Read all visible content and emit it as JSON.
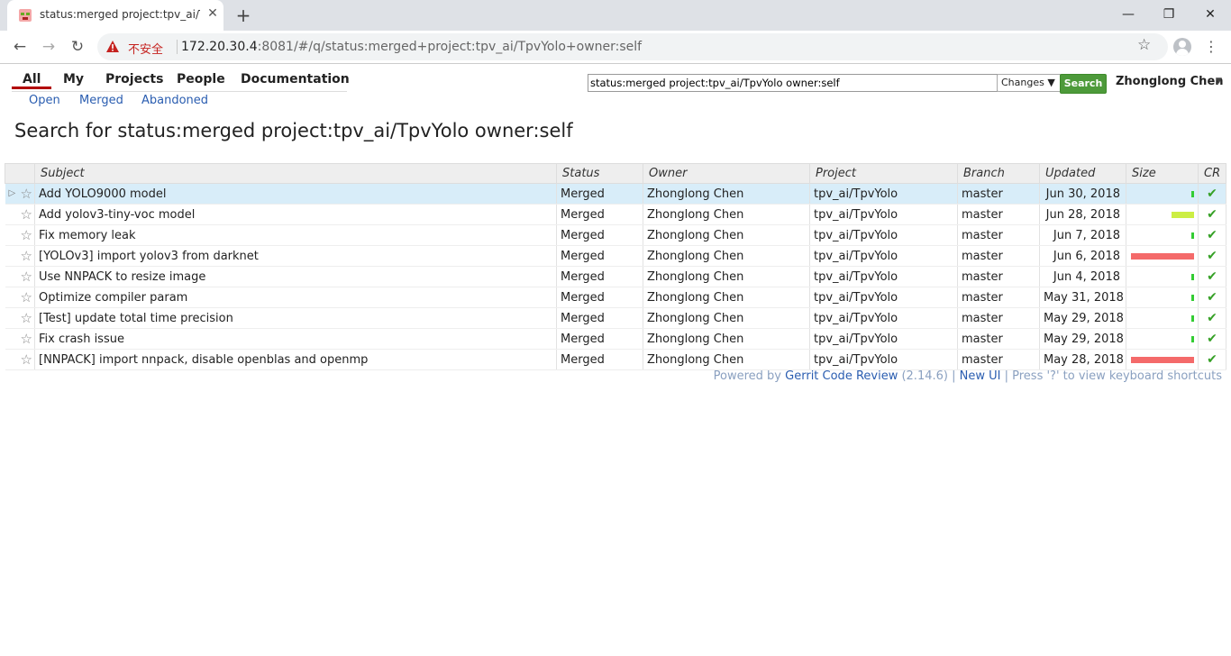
{
  "browser": {
    "tab_title": "status:merged project:tpv_ai/TpvYolo owner:self",
    "address_security": "不安全",
    "address_host": "172.20.30.4",
    "address_rest": ":8081/#/q/status:merged+project:tpv_ai/TpvYolo+owner:self"
  },
  "nav": {
    "tabs": [
      "All",
      "My",
      "Projects",
      "People",
      "Documentation"
    ],
    "subtabs": [
      "Open",
      "Merged",
      "Abandoned"
    ],
    "search_value": "status:merged project:tpv_ai/TpvYolo owner:self",
    "dropdown_value": "Changes",
    "search_button": "Search",
    "user_name": "Zhonglong Chen"
  },
  "title": "Search for status:merged project:tpv_ai/TpvYolo owner:self",
  "table": {
    "headers": [
      "Subject",
      "Status",
      "Owner",
      "Project",
      "Branch",
      "Updated",
      "Size",
      "CR"
    ],
    "rows": [
      {
        "subject": "Add YOLO9000 model",
        "status": "Merged",
        "owner": "Zhonglong Chen",
        "project": "tpv_ai/TpvYolo",
        "branch": "master",
        "updated": "Jun 30, 2018",
        "size_bar": 0.04,
        "size_color": "#33cc33",
        "cr": "✔"
      },
      {
        "subject": "Add yolov3-tiny-voc model",
        "status": "Merged",
        "owner": "Zhonglong Chen",
        "project": "tpv_ai/TpvYolo",
        "branch": "master",
        "updated": "Jun 28, 2018",
        "size_bar": 0.36,
        "size_color": "#ccee44",
        "cr": "✔"
      },
      {
        "subject": "Fix memory leak",
        "status": "Merged",
        "owner": "Zhonglong Chen",
        "project": "tpv_ai/TpvYolo",
        "branch": "master",
        "updated": "Jun 7, 2018",
        "size_bar": 0.04,
        "size_color": "#33cc33",
        "cr": "✔"
      },
      {
        "subject": "[YOLOv3] import yolov3 from darknet",
        "status": "Merged",
        "owner": "Zhonglong Chen",
        "project": "tpv_ai/TpvYolo",
        "branch": "master",
        "updated": "Jun 6, 2018",
        "size_bar": 1.0,
        "size_color": "#f46a6a",
        "cr": "✔"
      },
      {
        "subject": "Use NNPACK to resize image",
        "status": "Merged",
        "owner": "Zhonglong Chen",
        "project": "tpv_ai/TpvYolo",
        "branch": "master",
        "updated": "Jun 4, 2018",
        "size_bar": 0.04,
        "size_color": "#33cc33",
        "cr": "✔"
      },
      {
        "subject": "Optimize compiler param",
        "status": "Merged",
        "owner": "Zhonglong Chen",
        "project": "tpv_ai/TpvYolo",
        "branch": "master",
        "updated": "May 31, 2018",
        "size_bar": 0.04,
        "size_color": "#33cc33",
        "cr": "✔"
      },
      {
        "subject": "[Test] update total time precision",
        "status": "Merged",
        "owner": "Zhonglong Chen",
        "project": "tpv_ai/TpvYolo",
        "branch": "master",
        "updated": "May 29, 2018",
        "size_bar": 0.04,
        "size_color": "#33cc33",
        "cr": "✔"
      },
      {
        "subject": "Fix crash issue",
        "status": "Merged",
        "owner": "Zhonglong Chen",
        "project": "tpv_ai/TpvYolo",
        "branch": "master",
        "updated": "May 29, 2018",
        "size_bar": 0.04,
        "size_color": "#33cc33",
        "cr": "✔"
      },
      {
        "subject": "[NNPACK] import nnpack, disable openblas and openmp",
        "status": "Merged",
        "owner": "Zhonglong Chen",
        "project": "tpv_ai/TpvYolo",
        "branch": "master",
        "updated": "May 28, 2018",
        "size_bar": 1.0,
        "size_color": "#f46a6a",
        "cr": "✔"
      }
    ]
  },
  "footer": {
    "powered_by": "Powered by",
    "gerrit_link": "Gerrit Code Review",
    "version": "(2.14.6) |",
    "new_ui": "New UI",
    "shortcuts": "| Press '?' to view keyboard shortcuts"
  }
}
